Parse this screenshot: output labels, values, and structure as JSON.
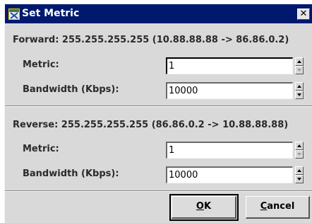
{
  "window": {
    "title": "Set Metric",
    "close_glyph": "✕"
  },
  "forward": {
    "heading": "Forward: 255.255.255.255 (10.88.88.88 -> 86.86.0.2)",
    "metric_label": "Metric:",
    "metric_value": "1",
    "bandwidth_label": "Bandwidth (Kbps):",
    "bandwidth_value": "10000"
  },
  "reverse": {
    "heading": "Reverse: 255.255.255.255 (86.86.0.2 -> 10.88.88.88)",
    "metric_label": "Metric:",
    "metric_value": "1",
    "bandwidth_label": "Bandwidth (Kbps):",
    "bandwidth_value": "10000"
  },
  "buttons": {
    "ok_mnemonic": "O",
    "ok_rest": "K",
    "cancel_mnemonic": "C",
    "cancel_rest": "ancel"
  },
  "icons": {
    "app": "app-window-icon",
    "spin_up": "spin-up-icon",
    "spin_down": "spin-down-icon"
  }
}
